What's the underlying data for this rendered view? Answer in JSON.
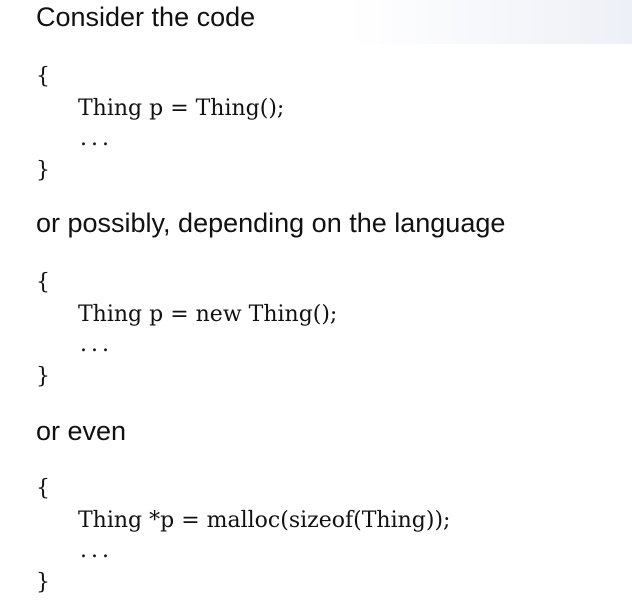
{
  "slide": {
    "intro": "Consider the code",
    "snippet1": {
      "open": "{",
      "line": "Thing p = Thing();",
      "ellipsis": "...",
      "close": "}"
    },
    "middle": "or possibly, depending on the language",
    "snippet2": {
      "open": "{",
      "line": "Thing p = new Thing();",
      "ellipsis": "...",
      "close": "}"
    },
    "outro": "or even",
    "snippet3": {
      "open": "{",
      "line": "Thing *p = malloc(sizeof(Thing));",
      "ellipsis": "...",
      "close": "}"
    }
  }
}
